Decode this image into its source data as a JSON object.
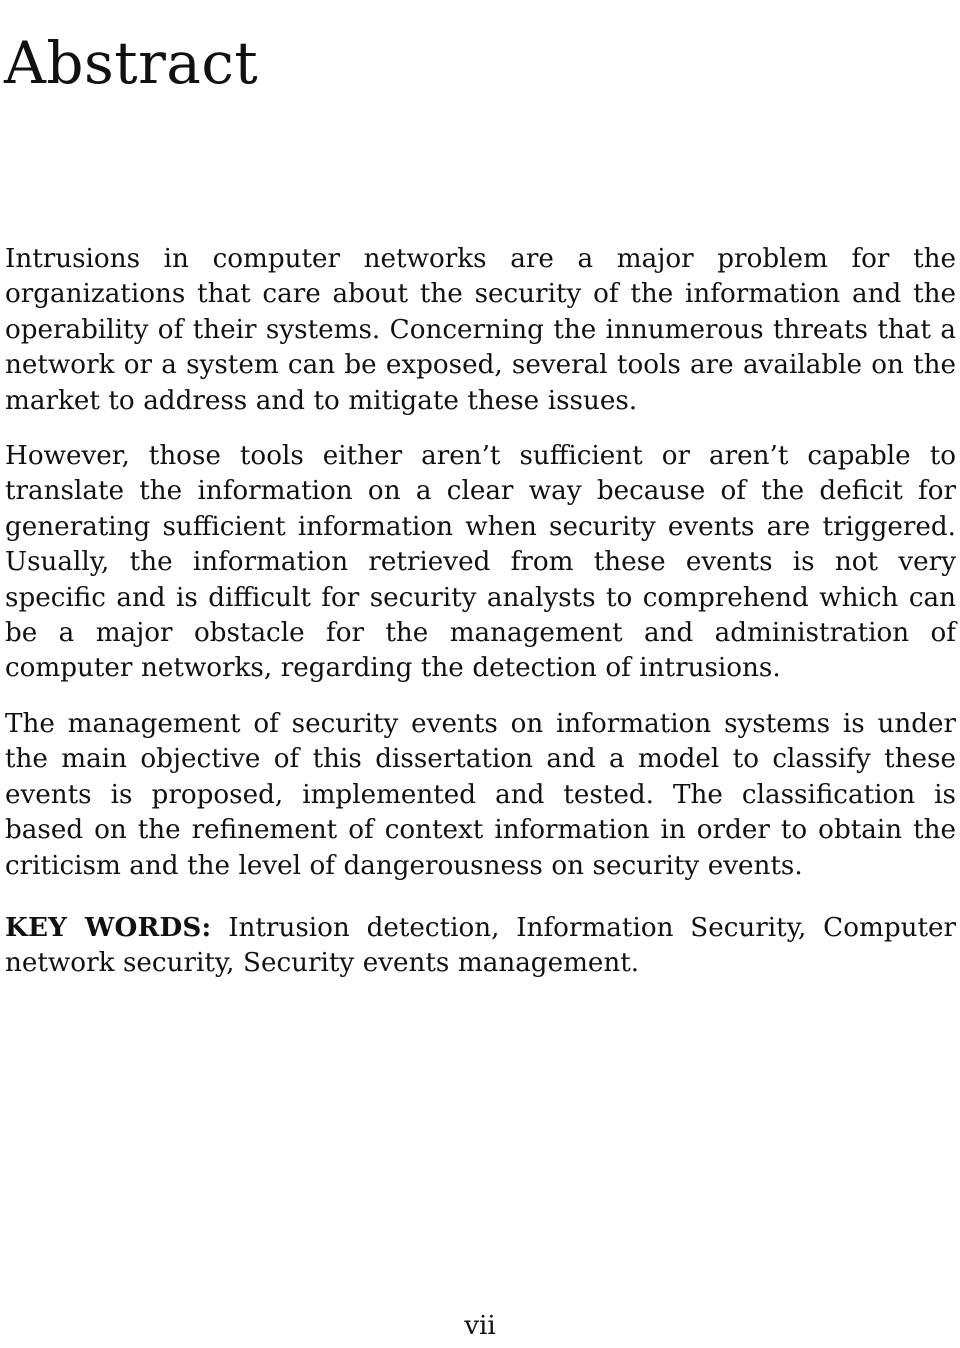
{
  "document": {
    "heading": "Abstract",
    "page_number": "vii",
    "background_color": "#ffffff",
    "text_color": "#111111",
    "paragraphs": [
      {
        "id": "paragraph-1",
        "text": "Intrusions in computer networks are a major problem for the organizations that care about the security of the information and the operability of their systems.  Concerning the innumerous threats that a network or a system can be exposed, several tools are available on the market to address and to mitigate these issues."
      },
      {
        "id": "paragraph-2",
        "text": "However, those tools either aren’t sufficient or aren’t capable to translate the information on a clear way because of the deficit for generating sufficient information when security events are triggered.  Usually, the information retrieved from these events is not very specific and is difficult for security analysts to comprehend which can be a major obstacle for the management and administration of computer networks, regarding the detection of intrusions."
      },
      {
        "id": "paragraph-3",
        "text": "The management of security events on information systems is under the main objective of this dissertation and a model to classify these events is proposed, implemented and tested.  The classification is based on the refinement of context information in order to obtain the criticism and the level of dangerousness on security events."
      }
    ],
    "keywords": {
      "label": "KEY WORDS:",
      "list": "Intrusion detection, Information Security, Computer network security, Security events management."
    }
  }
}
